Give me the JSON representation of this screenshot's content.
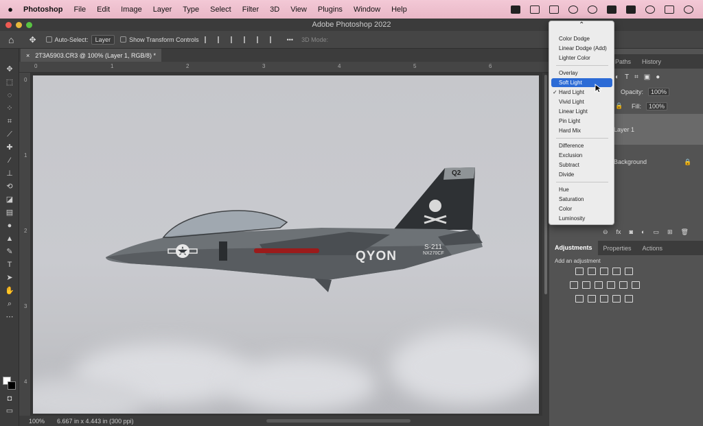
{
  "menubar": {
    "app": "Photoshop",
    "items": [
      "File",
      "Edit",
      "Image",
      "Layer",
      "Type",
      "Select",
      "Filter",
      "3D",
      "View",
      "Plugins",
      "Window",
      "Help"
    ]
  },
  "window": {
    "title": "Adobe Photoshop 2022"
  },
  "options": {
    "auto_select_label": "Auto-Select:",
    "auto_select_value": "Layer",
    "transform_label": "Show Transform Controls",
    "mode3d": "3D Mode:",
    "more": "•••"
  },
  "document": {
    "tab": "2T3A5903.CR3 @ 100% (Layer 1, RGB/8) *",
    "zoom": "100%",
    "info": "6.667 in x 4.443 in (300 ppi)"
  },
  "rulers": {
    "h": [
      "0",
      "1",
      "2",
      "3",
      "4",
      "5",
      "6"
    ],
    "v": [
      "0",
      "1",
      "2",
      "3",
      "4"
    ]
  },
  "aircraft": {
    "text_main": "QYON",
    "tail_code": "Q2",
    "serial": "S-211",
    "reg": "NX270CF"
  },
  "layers_panel": {
    "tabs": [
      "Paths",
      "History"
    ],
    "opacity_label": "Opacity:",
    "opacity": "100%",
    "fill_label": "Fill:",
    "fill": "100%",
    "layers": [
      "Layer 1",
      "Background"
    ]
  },
  "adjustments": {
    "tabs": [
      "Adjustments",
      "Properties",
      "Actions"
    ],
    "hint": "Add an adjustment"
  },
  "blend_menu": {
    "groups": [
      [
        "Color Dodge",
        "Linear Dodge (Add)",
        "Lighter Color"
      ],
      [
        "Overlay",
        "Soft Light",
        "Hard Light",
        "Vivid Light",
        "Linear Light",
        "Pin Light",
        "Hard Mix"
      ],
      [
        "Difference",
        "Exclusion",
        "Subtract",
        "Divide"
      ],
      [
        "Hue",
        "Saturation",
        "Color",
        "Luminosity"
      ]
    ],
    "highlighted": "Soft Light",
    "checked": "Hard Light",
    "scroll_up": "⌃"
  },
  "colors": {
    "accent": "#2c6bd6",
    "panel": "#535353",
    "dark": "#3c3c3c",
    "menubar": "#ecbccb"
  }
}
